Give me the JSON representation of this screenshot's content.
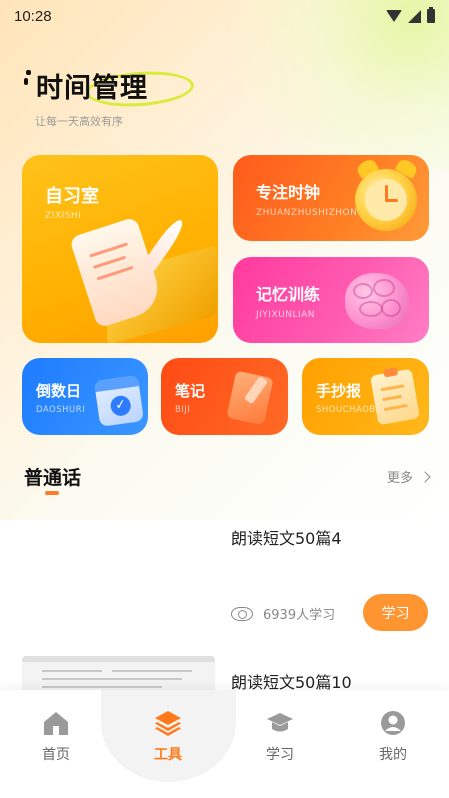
{
  "status_bar": {
    "time": "10:28"
  },
  "header": {
    "title": "时间管理",
    "subtitle": "让每一天高效有序"
  },
  "cards": {
    "zixishi": {
      "title": "自习室",
      "pinyin": "ZIXISHI"
    },
    "zhuanzhu": {
      "title": "专注时钟",
      "pinyin": "ZHUANZHUSHIZHONG"
    },
    "jiyi": {
      "title": "记忆训练",
      "pinyin": "JIYIXUNLIAN"
    },
    "daoshu": {
      "title": "倒数日",
      "pinyin": "DAOSHURI"
    },
    "biji": {
      "title": "笔记",
      "pinyin": "BIJI"
    },
    "shouchao": {
      "title": "手抄报",
      "pinyin": "SHOUCHAOBAO"
    }
  },
  "section": {
    "title": "普通话",
    "more": "更多"
  },
  "items": [
    {
      "title": "朗读短文50篇4",
      "views": "6939人学习",
      "button": "学习"
    },
    {
      "title": "朗读短文50篇10"
    }
  ],
  "tabbar": [
    {
      "label": "首页",
      "icon": "home-icon"
    },
    {
      "label": "工具",
      "icon": "layers-icon",
      "active": true
    },
    {
      "label": "学习",
      "icon": "graduation-cap-icon"
    },
    {
      "label": "我的",
      "icon": "user-icon"
    }
  ],
  "colors": {
    "accent": "#ff7a1a",
    "button": "#ff9530",
    "highlight_ring": "#d8ec3a"
  }
}
